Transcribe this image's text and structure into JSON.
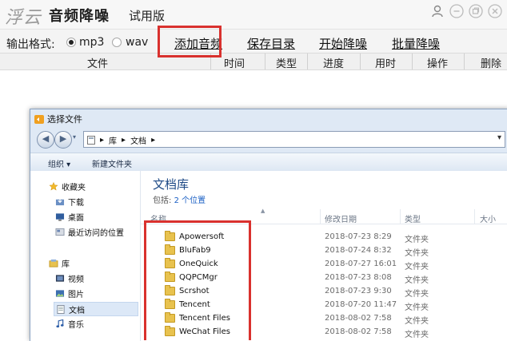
{
  "app": {
    "logo": "浮云",
    "name": "音频降噪",
    "edition": "试用版"
  },
  "window_buttons": [
    {
      "icon": "user-icon"
    },
    {
      "icon": "minimize-icon"
    },
    {
      "icon": "restore-icon"
    },
    {
      "icon": "close-icon"
    }
  ],
  "toolbar": {
    "format_label": "输出格式:",
    "format_options": [
      {
        "label": "mp3",
        "selected": true
      },
      {
        "label": "wav",
        "selected": false
      }
    ],
    "add_audio": "添加音频",
    "save_dir": "保存目录",
    "start": "开始降噪",
    "batch": "批量降噪"
  },
  "columns": [
    "文件",
    "时间",
    "类型",
    "进度",
    "用时",
    "操作",
    "删除"
  ],
  "dialog": {
    "title": "选择文件",
    "breadcrumbs": [
      "库",
      "文档"
    ],
    "commands": {
      "organize": "组织 ▾",
      "new_folder": "新建文件夹"
    },
    "nav": {
      "favorites": "收藏夹",
      "downloads": "下载",
      "desktop": "桌面",
      "recent": "最近访问的位置",
      "libraries": "库",
      "videos": "视频",
      "pictures": "图片",
      "documents": "文档",
      "music": "音乐"
    },
    "library_title": "文档库",
    "library_sub_prefix": "包括:",
    "library_sub_link": "2 个位置",
    "list_headers": {
      "name": "名称",
      "date": "修改日期",
      "type": "类型",
      "size": "大小"
    },
    "files": [
      {
        "name": "Apowersoft",
        "date": "2018-07-23 8:29",
        "type": "文件夹"
      },
      {
        "name": "BluFab9",
        "date": "2018-07-24 8:32",
        "type": "文件夹"
      },
      {
        "name": "OneQuick",
        "date": "2018-07-27 16:01",
        "type": "文件夹"
      },
      {
        "name": "QQPCMgr",
        "date": "2018-07-23 8:08",
        "type": "文件夹"
      },
      {
        "name": "Scrshot",
        "date": "2018-07-23 9:30",
        "type": "文件夹"
      },
      {
        "name": "Tencent",
        "date": "2018-07-20 11:47",
        "type": "文件夹"
      },
      {
        "name": "Tencent Files",
        "date": "2018-08-02 7:58",
        "type": "文件夹"
      },
      {
        "name": "WeChat Files",
        "date": "2018-08-02 7:58",
        "type": "文件夹"
      }
    ]
  },
  "colors": {
    "highlight": "#d9312e",
    "link": "#1a5fc4",
    "library_title": "#1e4a86"
  }
}
